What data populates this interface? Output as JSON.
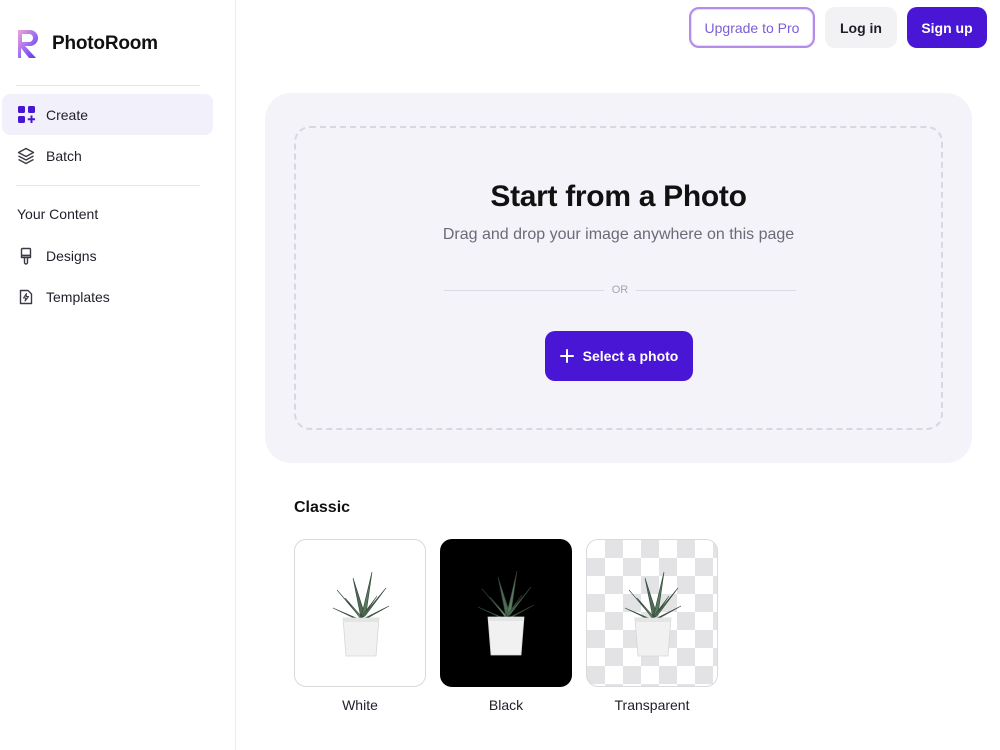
{
  "app": {
    "name": "PhotoRoom"
  },
  "sidebar": {
    "items": [
      {
        "label": "Create",
        "icon": "grid-plus-icon",
        "active": true
      },
      {
        "label": "Batch",
        "icon": "layers-icon",
        "active": false
      }
    ],
    "section_label": "Your Content",
    "content_items": [
      {
        "label": "Designs",
        "icon": "brush-icon"
      },
      {
        "label": "Templates",
        "icon": "template-bolt-icon"
      }
    ]
  },
  "header": {
    "upgrade_label": "Upgrade to Pro",
    "login_label": "Log in",
    "signup_label": "Sign up"
  },
  "upload": {
    "title": "Start from a Photo",
    "subtitle": "Drag and drop your image anywhere on this page",
    "or_text": "OR",
    "select_label": "Select a photo"
  },
  "classic": {
    "heading": "Classic",
    "cards": [
      {
        "label": "White"
      },
      {
        "label": "Black"
      },
      {
        "label": "Transparent"
      }
    ]
  },
  "colors": {
    "accent": "#4a16d6",
    "panel_bg": "#f4f3f9",
    "active_nav_bg": "#f2f0fb"
  }
}
